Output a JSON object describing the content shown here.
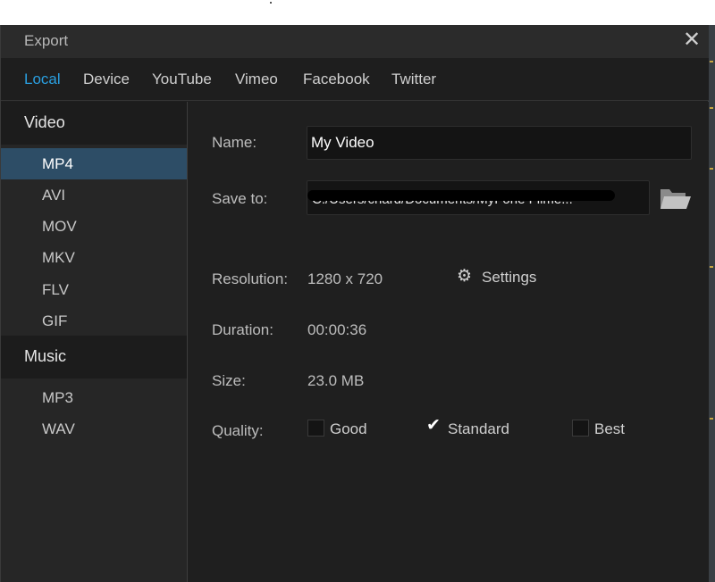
{
  "dialog": {
    "title": "Export",
    "close_glyph": "✕",
    "icons": {
      "close": "close-icon",
      "folder": "folder-icon",
      "gear": "gear-icon",
      "check": "checkmark-icon"
    }
  },
  "tabs": [
    {
      "label": "Local",
      "active": true
    },
    {
      "label": "Device",
      "active": false
    },
    {
      "label": "YouTube",
      "active": false
    },
    {
      "label": "Vimeo",
      "active": false
    },
    {
      "label": "Facebook",
      "active": false
    },
    {
      "label": "Twitter",
      "active": false
    }
  ],
  "sidebar": {
    "video": {
      "heading": "Video",
      "items": [
        "MP4",
        "AVI",
        "MOV",
        "MKV",
        "FLV",
        "GIF"
      ],
      "selected": "MP4"
    },
    "music": {
      "heading": "Music",
      "items": [
        "MP3",
        "WAV"
      ]
    }
  },
  "form": {
    "name": {
      "label": "Name:",
      "value": "My Video"
    },
    "save_to": {
      "label": "Save to:",
      "value": "C:/Users/chard/Documents/MyFone Filme..."
    },
    "resolution": {
      "label": "Resolution:",
      "value": "1280 x 720"
    },
    "settings_label": "Settings",
    "gear_glyph": "⚙",
    "duration": {
      "label": "Duration:",
      "value": "00:00:36"
    },
    "size": {
      "label": "Size:",
      "value": "23.0 MB"
    },
    "quality": {
      "label": "Quality:",
      "check_glyph": "✔",
      "options": [
        {
          "label": "Good",
          "checked": false
        },
        {
          "label": "Standard",
          "checked": true
        },
        {
          "label": "Best",
          "checked": false
        }
      ]
    }
  },
  "colors": {
    "accent": "#2a9fe0",
    "selected_row": "#2d4d66",
    "background": "#1f1f1f",
    "titlebar": "#2b2b2b"
  }
}
